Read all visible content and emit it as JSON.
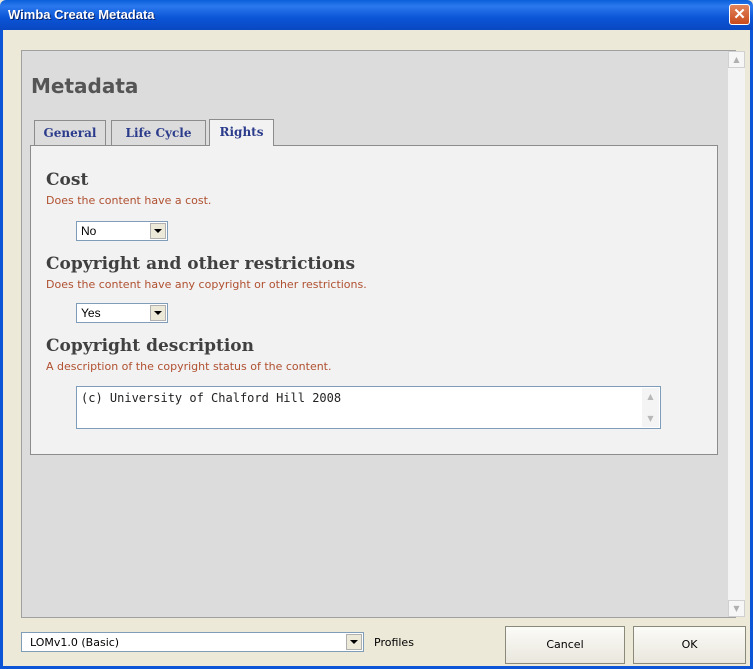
{
  "window": {
    "title": "Wimba Create Metadata"
  },
  "page": {
    "heading": "Metadata"
  },
  "tabs": [
    {
      "label": "General",
      "active": false
    },
    {
      "label": "Life Cycle",
      "active": false
    },
    {
      "label": "Rights",
      "active": true
    }
  ],
  "rights": {
    "cost": {
      "title": "Cost",
      "description": "Does the content have a cost.",
      "value": "No"
    },
    "copyright": {
      "title": "Copyright and other restrictions",
      "description": "Does the content have any copyright or other restrictions.",
      "value": "Yes"
    },
    "copyright_description": {
      "title": "Copyright description",
      "description": "A description of the copyright status of the content.",
      "value": "(c) University of Chalford Hill 2008"
    }
  },
  "footer": {
    "profile_value": "LOMv1.0 (Basic)",
    "profiles_label": "Profiles",
    "cancel_label": "Cancel",
    "ok_label": "OK"
  }
}
